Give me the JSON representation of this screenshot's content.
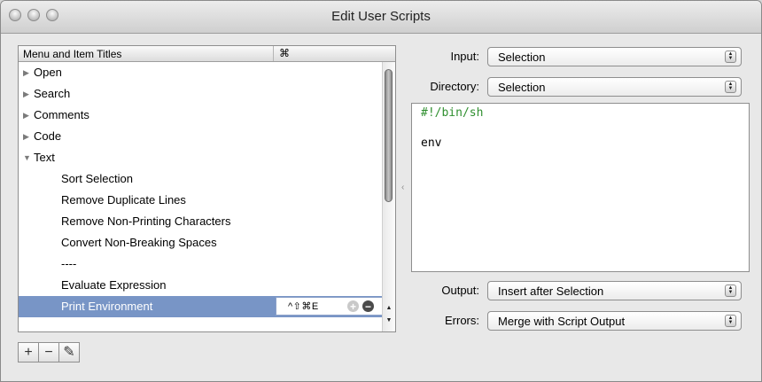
{
  "window": {
    "title": "Edit User Scripts"
  },
  "list": {
    "headers": {
      "title": "Menu and Item Titles",
      "shortcut": "⌘"
    },
    "groups": [
      "Open",
      "Search",
      "Comments",
      "Code"
    ],
    "text_group": "Text",
    "items": [
      "Sort Selection",
      "Remove Duplicate Lines",
      "Remove Non-Printing Characters",
      "Convert Non-Breaking Spaces",
      "----",
      "Evaluate Expression"
    ],
    "selected_item": "Print Environment",
    "selected_shortcut": "^⇧⌘E"
  },
  "input": {
    "label": "Input:",
    "value": "Selection"
  },
  "directory": {
    "label": "Directory:",
    "value": "Selection"
  },
  "editor": {
    "line1": "#!/bin/sh",
    "line2": "env"
  },
  "output": {
    "label": "Output:",
    "value": "Insert after Selection"
  },
  "errors": {
    "label": "Errors:",
    "value": "Merge with Script Output"
  },
  "toolbar": {
    "add": "+",
    "remove": "−",
    "edit": "✎"
  },
  "colors": {
    "selection": "#7895c6",
    "shebang": "#2f8f2f"
  }
}
